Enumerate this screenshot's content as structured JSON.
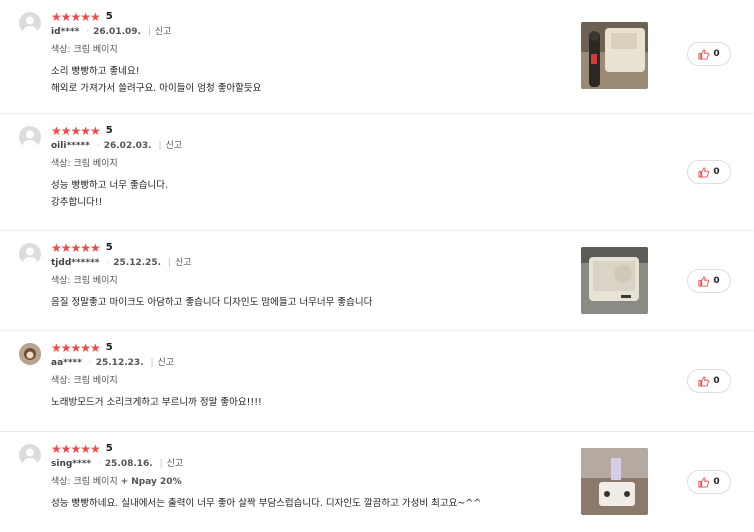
{
  "reviews": [
    {
      "score": "5",
      "stars": "★★★★★",
      "user": "id****",
      "date": "26.01.09.",
      "report": "신고",
      "option_label": "색상: 크림 베이지",
      "option_extra": "",
      "lines": [
        "소리 빵빵하고 좋네요!",
        "해외로 가져가서 쓸려구요. 아이들이 엄청 좋아할듯요"
      ],
      "likes": "0",
      "has_photo": true
    },
    {
      "score": "5",
      "stars": "★★★★★",
      "user": "oili*****",
      "date": "26.02.03.",
      "report": "신고",
      "option_label": "색상: 크림 베이지",
      "option_extra": "",
      "lines": [
        "성능 빵빵하고 너무 좋습니다.",
        "강추합니다!!"
      ],
      "likes": "0",
      "has_photo": false
    },
    {
      "score": "5",
      "stars": "★★★★★",
      "user": "tjdd******",
      "date": "25.12.25.",
      "report": "신고",
      "option_label": "색상: 크림 베이지",
      "option_extra": "",
      "lines": [
        "음질 정말좋고 마이크도 아담하고 좋습니다 디자인도 맘에들고 너무너무 좋습니다"
      ],
      "likes": "0",
      "has_photo": true
    },
    {
      "score": "5",
      "stars": "★★★★★",
      "user": "aa****",
      "date": "25.12.23.",
      "report": "신고",
      "option_label": "색상: 크림 베이지",
      "option_extra": "",
      "lines": [
        "노래방모드거 소리크게하고 부르니까 정말 좋아요!!!!"
      ],
      "likes": "0",
      "has_photo": false
    },
    {
      "score": "5",
      "stars": "★★★★★",
      "user": "sing****",
      "date": "25.08.16.",
      "report": "신고",
      "option_label": "색상: 크림 베이지",
      "option_extra": "+ Npay 20%",
      "lines": [
        "성능 빵빵하네요. 실내에서는 출력이 너무 좋아 살짝 부담스럽습니다. 디자인도 깔끔하고 가성비 최고요~^^"
      ],
      "likes": "0",
      "has_photo": true
    }
  ],
  "colors": {
    "star": "#f04a4a",
    "border": "#ececec",
    "like_icon": "#f04a4a"
  },
  "icons": {
    "like": "thumbs-up-icon",
    "avatar": "default-avatar-icon"
  }
}
